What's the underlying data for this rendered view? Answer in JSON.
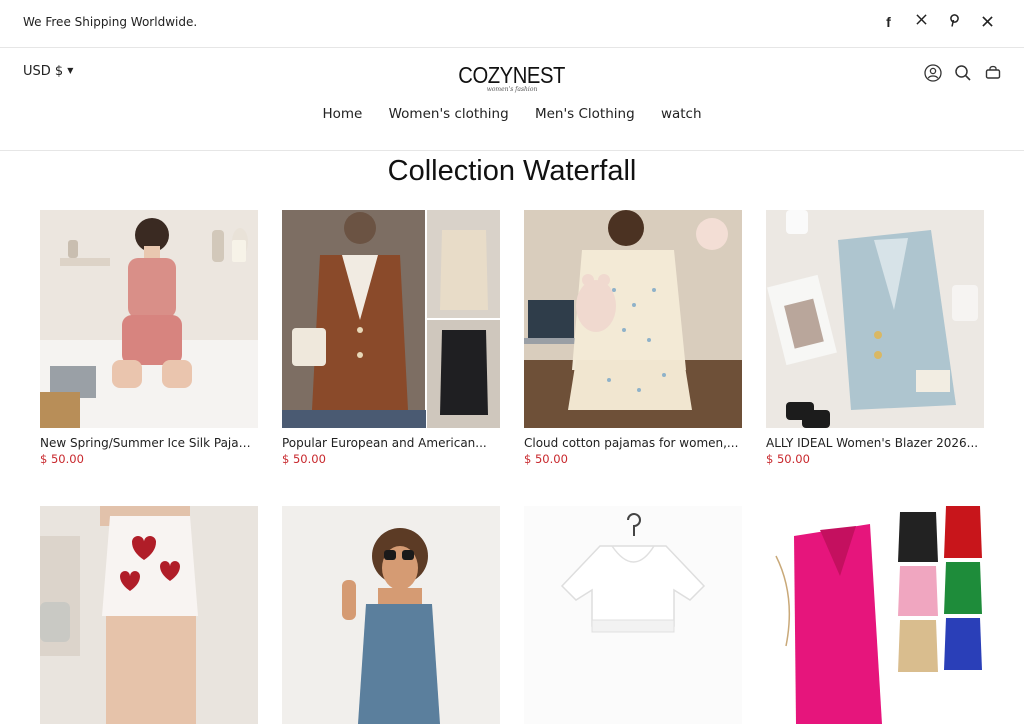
{
  "announcement": "We Free Shipping Worldwide.",
  "currency": "USD $",
  "logo": {
    "name": "COZYNEST",
    "tagline": "women's fashion"
  },
  "nav": [
    "Home",
    "Women's clothing",
    "Men's Clothing",
    "watch"
  ],
  "collection_title": "Collection Waterfall",
  "products": [
    {
      "title": "New Spring/Summer Ice Silk Pajama...",
      "price": "$ 50.00"
    },
    {
      "title": "Popular European and American...",
      "price": "$ 50.00"
    },
    {
      "title": "Cloud cotton pajamas for women,...",
      "price": "$ 50.00"
    },
    {
      "title": "ALLY IDEAL Women's Blazer 2026...",
      "price": "$ 50.00"
    }
  ],
  "colors": {
    "price": "#c8282d",
    "border": "#e6e6e6"
  }
}
